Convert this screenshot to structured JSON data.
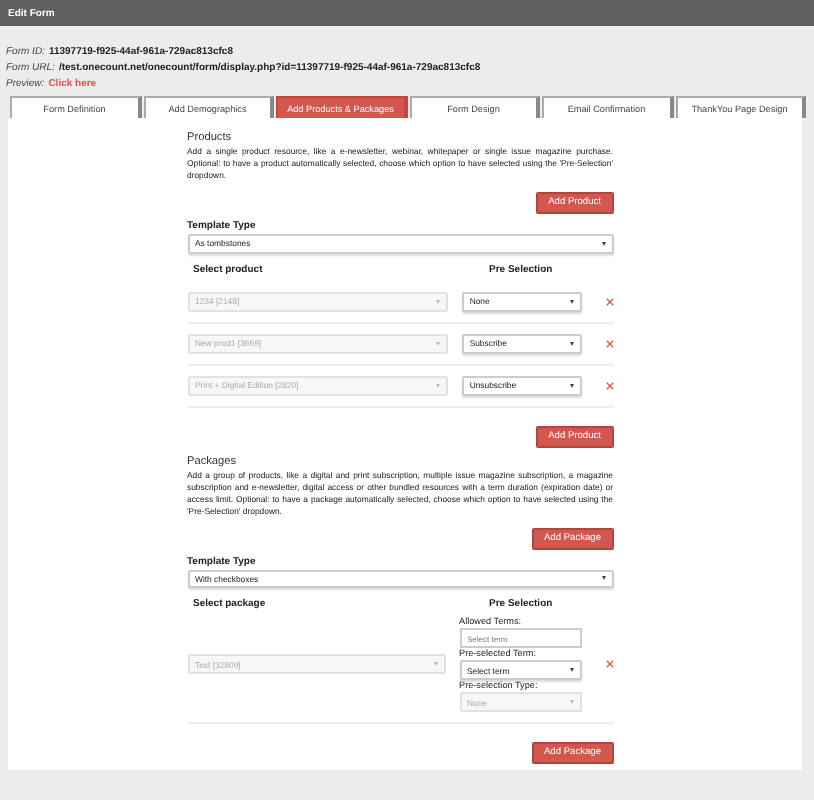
{
  "header": {
    "title": "Edit Form"
  },
  "info": [
    {
      "label": "Form ID:",
      "value": "11397719-f925-44af-961a-729ac813cfc8",
      "kind": "text"
    },
    {
      "label": "Form URL:",
      "value": "/test.onecount.net/onecount/form/display.php?id=11397719-f925-44af-961a-729ac813cfc8",
      "kind": "text"
    },
    {
      "label": "Preview:",
      "value": "Click here",
      "kind": "link"
    }
  ],
  "tabs": [
    {
      "label": "Form Definition",
      "selected": false
    },
    {
      "label": "Add Demographics",
      "selected": false
    },
    {
      "label": "Add Products & Packages",
      "selected": true
    },
    {
      "label": "Form Design",
      "selected": false
    },
    {
      "label": "Email Confirmation",
      "selected": false
    },
    {
      "label": "ThankYou Page Design",
      "selected": false
    }
  ],
  "products": {
    "title": "Products",
    "description": "Add a single product resource, like a e-newsletter, webinar, whitepaper or single issue magazine purchase. Optional: to have a product automatically selected, choose which option to have selected using the 'Pre-Selection' dropdown.",
    "add_button": "Add Product",
    "template_label": "Template Type",
    "template_value": "As tombstones",
    "columns": [
      "Select product",
      "Pre Selection"
    ],
    "rows": [
      {
        "product": "1234 [2148]",
        "pre_selection": "None",
        "disabled": true
      },
      {
        "product": "New prod1 [3669]",
        "pre_selection": "Subscribe",
        "disabled": true
      },
      {
        "product": "Print + Digital Edition [2820]",
        "pre_selection": "Unsubscribe",
        "disabled": true
      }
    ],
    "add_button_bottom": "Add Product"
  },
  "packages": {
    "title": "Packages",
    "description": "Add a group of products, like a digital and print subscription, multiple issue magazine subscription, a magazine subscription and e-newsletter, digital access or other bundled resources with a term duration (expiration date) or access limit. Optional: to have a package automatically selected, choose which option to have selected using the 'Pre-Selection' dropdown.",
    "add_button": "Add Package",
    "template_label": "Template Type",
    "template_value": "With checkboxes",
    "columns": [
      "Select package",
      "Pre Selection"
    ],
    "rows": [
      {
        "package": "Test [32809]",
        "disabled": true,
        "allowed_terms_label": "Allowed Terms:",
        "allowed_terms_placeholder": "Select term",
        "term_label": "Pre-selected Term:",
        "term_value": "Select term",
        "type_label": "Pre-selection Type:",
        "type_value": "None",
        "type_disabled": true
      }
    ],
    "add_button_bottom": "Add Package"
  }
}
